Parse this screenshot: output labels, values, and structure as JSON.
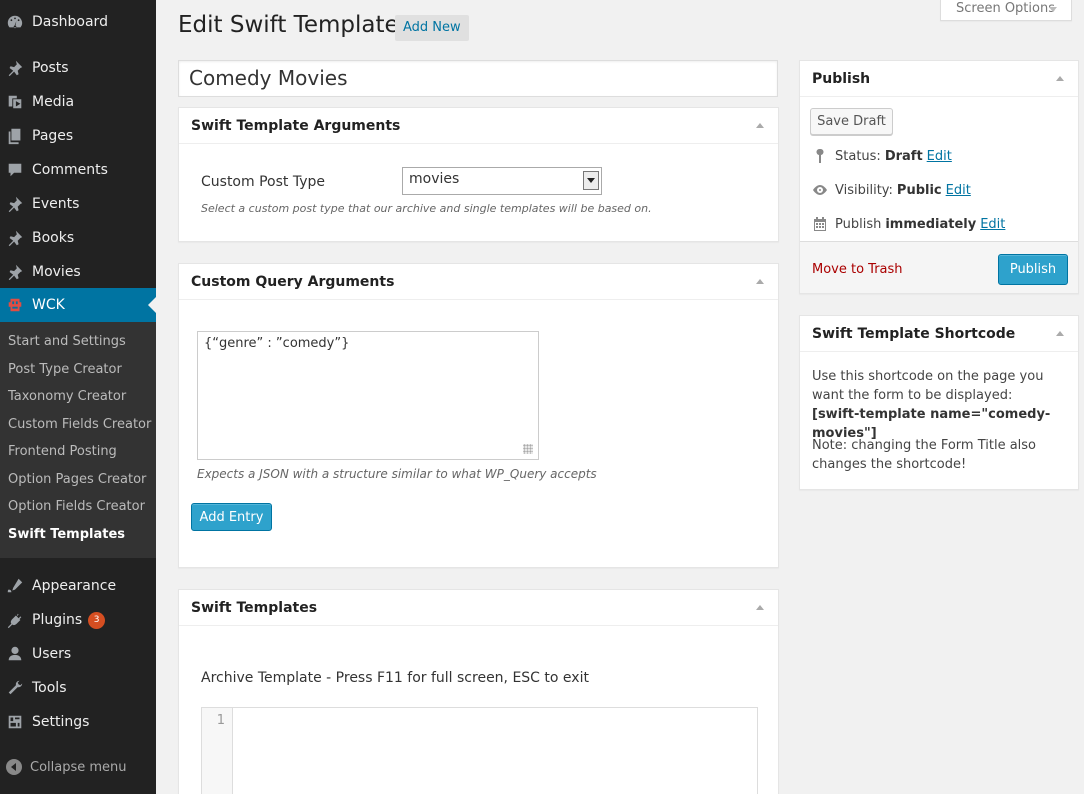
{
  "screen_options": "Screen Options",
  "header": {
    "title": "Edit Swift Template",
    "add_new": "Add New"
  },
  "title_field": {
    "value": "Comedy Movies"
  },
  "sidebar": {
    "items": [
      {
        "label": "Dashboard",
        "icon": "dashboard-icon"
      },
      {
        "label": "Posts",
        "icon": "pin-icon"
      },
      {
        "label": "Media",
        "icon": "media-icon"
      },
      {
        "label": "Pages",
        "icon": "pages-icon"
      },
      {
        "label": "Comments",
        "icon": "comments-icon"
      },
      {
        "label": "Events",
        "icon": "pin-icon"
      },
      {
        "label": "Books",
        "icon": "pin-icon"
      },
      {
        "label": "Movies",
        "icon": "pin-icon"
      },
      {
        "label": "WCK",
        "icon": "wck-icon"
      },
      {
        "label": "Appearance",
        "icon": "appearance-icon"
      },
      {
        "label": "Plugins",
        "icon": "plugins-icon",
        "badge": "3"
      },
      {
        "label": "Users",
        "icon": "users-icon"
      },
      {
        "label": "Tools",
        "icon": "tools-icon"
      },
      {
        "label": "Settings",
        "icon": "settings-icon"
      }
    ],
    "submenu": [
      "Start and Settings",
      "Post Type Creator",
      "Taxonomy Creator",
      "Custom Fields Creator",
      "Frontend Posting",
      "Option Pages Creator",
      "Option Fields Creator",
      "Swift Templates"
    ],
    "collapse": "Collapse menu"
  },
  "swift_args": {
    "title": "Swift Template Arguments",
    "label": "Custom Post Type",
    "select_value": "movies",
    "description": "Select a custom post type that our archive and single templates will be based on."
  },
  "query_args": {
    "title": "Custom Query Arguments",
    "textarea_value": "{“genre” : ”comedy”}",
    "description": "Expects a JSON with a structure similar to what WP_Query accepts",
    "add_entry": "Add Entry"
  },
  "swift_templates": {
    "title": "Swift Templates",
    "archive_label": "Archive Template - Press F11 for full screen, ESC to exit",
    "line_number": "1"
  },
  "publish": {
    "title": "Publish",
    "save_draft": "Save Draft",
    "status_label": "Status:",
    "status_value": "Draft",
    "visibility_label": "Visibility:",
    "visibility_value": "Public",
    "publish_label": "Publish",
    "publish_value": "immediately",
    "edit": "Edit",
    "trash": "Move to Trash",
    "publish_button": "Publish"
  },
  "shortcode": {
    "title": "Swift Template Shortcode",
    "line1": "Use this shortcode on the page you want the form to be displayed:",
    "code": "[swift-template name=\"comedy-movies\"]",
    "note": "Note: changing the Form Title also changes the shortcode!"
  },
  "colors": {
    "accent": "#0074a2",
    "button": "#2ea2cc",
    "sidebar": "#222222",
    "badge": "#d54e21",
    "trash": "#aa0000"
  }
}
